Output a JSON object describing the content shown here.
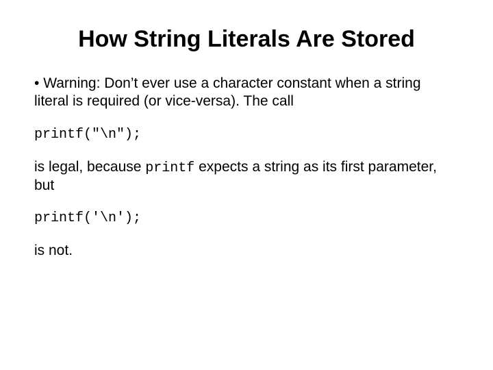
{
  "title": "How String Literals Are Stored",
  "bullet": "•",
  "p1a": " Warning: Don’t ever use a character constant when a string literal is required (or vice-versa). The call",
  "code1": "printf(\"\\n\");",
  "p2a": "is legal, because ",
  "p2_code": "printf",
  "p2b": " expects a string as its first parameter, but",
  "code2": "printf('\\n');",
  "p3": "is not."
}
